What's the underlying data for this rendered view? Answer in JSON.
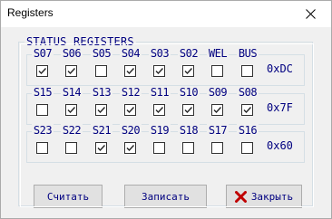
{
  "window": {
    "title": "Registers",
    "close_glyph": "✕"
  },
  "group_title": "STATUS REGISTERS",
  "registers": [
    {
      "labels": [
        "S07",
        "S06",
        "S05",
        "S04",
        "S03",
        "S02",
        "WEL",
        "BUS"
      ],
      "checked": [
        true,
        true,
        false,
        true,
        true,
        true,
        false,
        false
      ],
      "hex": "0xDC"
    },
    {
      "labels": [
        "S15",
        "S14",
        "S13",
        "S12",
        "S11",
        "S10",
        "S09",
        "S08"
      ],
      "checked": [
        false,
        true,
        true,
        true,
        true,
        true,
        true,
        true
      ],
      "hex": "0x7F"
    },
    {
      "labels": [
        "S23",
        "S22",
        "S21",
        "S20",
        "S19",
        "S18",
        "S17",
        "S16"
      ],
      "checked": [
        false,
        false,
        true,
        true,
        false,
        false,
        false,
        false
      ],
      "hex": "0x60"
    }
  ],
  "buttons": {
    "read": "Считать",
    "write": "Записать",
    "close": "Закрыть"
  },
  "colors": {
    "label_text": "#000080",
    "close_x_icon": "#c00000"
  },
  "icons": {
    "window_close": "close-icon",
    "button_close": "red-x-icon"
  }
}
